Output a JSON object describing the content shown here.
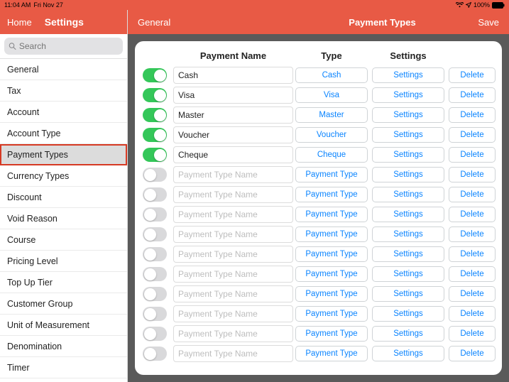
{
  "status": {
    "time": "11:04 AM",
    "date": "Fri Nov 27",
    "battery": "100%"
  },
  "left_header": {
    "home": "Home",
    "settings": "Settings"
  },
  "search": {
    "placeholder": "Search"
  },
  "sidebar": {
    "items": [
      {
        "label": "General",
        "selected": false
      },
      {
        "label": "Tax",
        "selected": false
      },
      {
        "label": "Account",
        "selected": false
      },
      {
        "label": "Account Type",
        "selected": false
      },
      {
        "label": "Payment Types",
        "selected": true
      },
      {
        "label": "Currency Types",
        "selected": false
      },
      {
        "label": "Discount",
        "selected": false
      },
      {
        "label": "Void Reason",
        "selected": false
      },
      {
        "label": "Course",
        "selected": false
      },
      {
        "label": "Pricing Level",
        "selected": false
      },
      {
        "label": "Top Up Tier",
        "selected": false
      },
      {
        "label": "Customer Group",
        "selected": false
      },
      {
        "label": "Unit of Measurement",
        "selected": false
      },
      {
        "label": "Denomination",
        "selected": false
      },
      {
        "label": "Timer",
        "selected": false
      }
    ]
  },
  "right_header": {
    "left": "General",
    "title": "Payment Types",
    "right": "Save"
  },
  "table": {
    "headers": {
      "name": "Payment Name",
      "type": "Type",
      "settings": "Settings"
    },
    "name_placeholder": "Payment Type Name",
    "type_placeholder": "Payment Type",
    "settings_label": "Settings",
    "delete_label": "Delete",
    "rows": [
      {
        "on": true,
        "name": "Cash",
        "type": "Cash"
      },
      {
        "on": true,
        "name": "Visa",
        "type": "Visa"
      },
      {
        "on": true,
        "name": "Master",
        "type": "Master"
      },
      {
        "on": true,
        "name": "Voucher",
        "type": "Voucher"
      },
      {
        "on": true,
        "name": "Cheque",
        "type": "Cheque"
      },
      {
        "on": false,
        "name": "",
        "type": ""
      },
      {
        "on": false,
        "name": "",
        "type": ""
      },
      {
        "on": false,
        "name": "",
        "type": ""
      },
      {
        "on": false,
        "name": "",
        "type": ""
      },
      {
        "on": false,
        "name": "",
        "type": ""
      },
      {
        "on": false,
        "name": "",
        "type": ""
      },
      {
        "on": false,
        "name": "",
        "type": ""
      },
      {
        "on": false,
        "name": "",
        "type": ""
      },
      {
        "on": false,
        "name": "",
        "type": ""
      },
      {
        "on": false,
        "name": "",
        "type": ""
      }
    ]
  },
  "colors": {
    "brand": "#e85a45",
    "link": "#0a84ff",
    "toggle_on": "#34c759"
  }
}
